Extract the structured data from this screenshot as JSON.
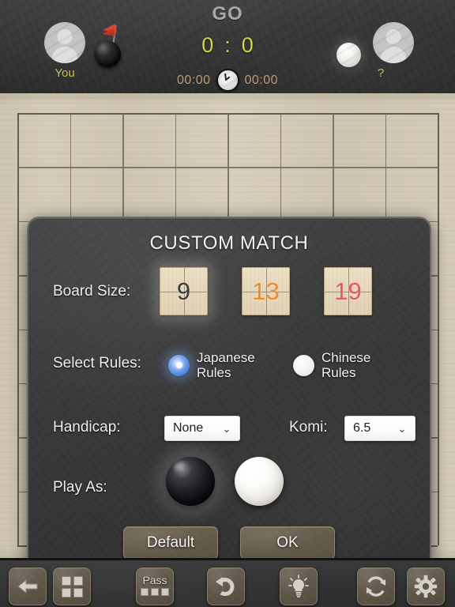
{
  "scorebar": {
    "game_title": "GO",
    "score_left": "0",
    "score_sep": ":",
    "score_right": "0",
    "time_left": "00:00",
    "time_right": "00:00",
    "clock_icon": "clock-icon",
    "player_left": {
      "name": "You",
      "avatar_icon": "avatar-icon",
      "stone": "black-stone",
      "flag_icon": "flag-icon"
    },
    "player_right": {
      "name": "?",
      "avatar_icon": "avatar-icon",
      "stone": "white-stone"
    }
  },
  "board": {
    "size": 9,
    "lines": 9
  },
  "dialog": {
    "title": "CUSTOM MATCH",
    "board_size": {
      "label": "Board Size:",
      "options": [
        {
          "value": "9",
          "color": "#3c3c3c",
          "selected": true
        },
        {
          "value": "13",
          "color": "#ef8a28",
          "selected": false
        },
        {
          "value": "19",
          "color": "#e8556e",
          "selected": false
        }
      ]
    },
    "rules": {
      "label": "Select Rules:",
      "options": [
        {
          "line1": "Japanese",
          "line2": "Rules",
          "selected": true
        },
        {
          "line1": "Chinese",
          "line2": "Rules",
          "selected": false
        }
      ]
    },
    "handicap": {
      "label": "Handicap:",
      "value": "None",
      "chevron": "chevron-down-icon"
    },
    "komi": {
      "label": "Komi:",
      "value": "6.5",
      "chevron": "chevron-down-icon"
    },
    "play_as": {
      "label": "Play As:",
      "options": [
        {
          "stone": "black",
          "selected": true
        },
        {
          "stone": "white",
          "selected": false
        }
      ]
    },
    "buttons": {
      "default_label": "Default",
      "ok_label": "OK"
    }
  },
  "toolbar": {
    "items": [
      {
        "name": "back-button",
        "icon": "arrow-left-icon"
      },
      {
        "name": "board-button",
        "icon": "grid-squares-icon"
      },
      {
        "name": "pass-button",
        "icon": "pass-icon",
        "label": "Pass"
      },
      {
        "name": "undo-button",
        "icon": "undo-arrow-icon"
      },
      {
        "name": "hint-button",
        "icon": "lightbulb-icon"
      },
      {
        "name": "restart-button",
        "icon": "refresh-icon"
      },
      {
        "name": "settings-button",
        "icon": "gear-icon"
      }
    ]
  },
  "colors": {
    "accent_score": "#cddb4a",
    "accent_time": "#b99c72",
    "board_wood": "#d2c9b5",
    "dialog_bg": "#3a3a3a",
    "radio_selected": "#4a7fd8",
    "size_9": "#3c3c3c",
    "size_13": "#ef8a28",
    "size_19": "#e8556e"
  }
}
